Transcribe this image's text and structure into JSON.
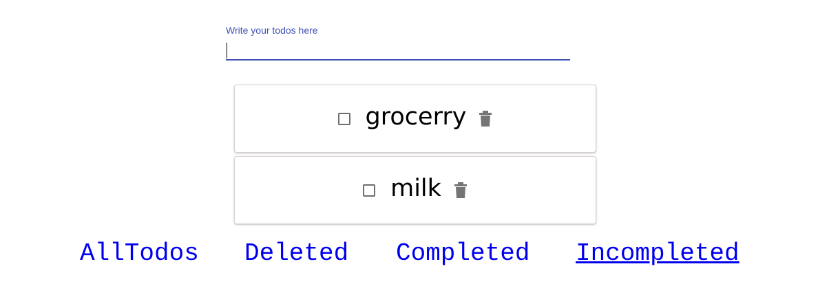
{
  "input": {
    "label": "Write your todos here",
    "value": "",
    "accent_color": "#3f51b5"
  },
  "todos": [
    {
      "text": "grocerry",
      "checked": false,
      "delete_icon": "trash-icon"
    },
    {
      "text": "milk",
      "checked": false,
      "delete_icon": "trash-icon"
    }
  ],
  "filters": {
    "all": "AllTodos",
    "deleted": "Deleted",
    "completed": "Completed",
    "incompleted": "Incompleted",
    "active": "incompleted",
    "link_color": "#0000ee"
  }
}
